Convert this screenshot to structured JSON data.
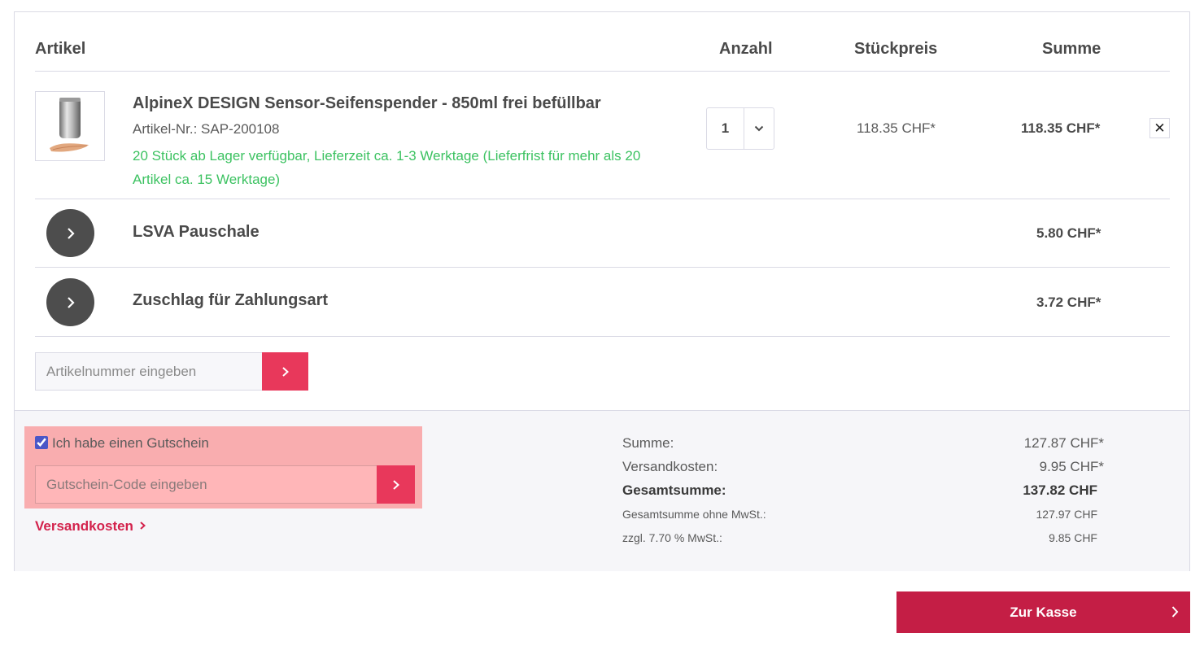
{
  "table_header": {
    "artikel": "Artikel",
    "anzahl": "Anzahl",
    "stueckpreis": "Stückpreis",
    "summe": "Summe"
  },
  "product": {
    "name": "AlpineX DESIGN Sensor-Seifenspender - 850ml frei befüllbar",
    "article_number": "Artikel-Nr.: SAP-200108",
    "availability": "20 Stück ab Lager verfügbar, Lieferzeit ca. 1-3 Werktage (Lieferfrist für mehr als 20 Artikel ca. 15 Werktage)",
    "quantity": "1",
    "unit_price": "118.35 CHF*",
    "total_price": "118.35 CHF*",
    "remove_label": "✕",
    "image_icon": "soap-dispenser-image"
  },
  "extra_rows": [
    {
      "title": "LSVA Pauschale",
      "price": "5.80 CHF*"
    },
    {
      "title": "Zuschlag für Zahlungsart",
      "price": "3.72 CHF*"
    }
  ],
  "article_input": {
    "placeholder": "Artikelnummer eingeben"
  },
  "voucher": {
    "checkbox_label": "Ich habe einen Gutschein",
    "checked": true,
    "placeholder": "Gutschein-Code eingeben"
  },
  "shipping_link": "Versandkosten",
  "summary": [
    {
      "label": "Summe:",
      "value": "127.87 CHF*"
    },
    {
      "label": "Versandkosten:",
      "value": "9.95 CHF*"
    },
    {
      "label": "Gesamtsumme:",
      "value": "137.82 CHF"
    },
    {
      "label": "Gesamtsumme ohne MwSt.:",
      "value": "127.97 CHF"
    },
    {
      "label": "zzgl. 7.70 % MwSt.:",
      "value": "9.85 CHF"
    }
  ],
  "checkout_label": "Zur Kasse",
  "colors": {
    "accent_red": "#e8385b",
    "checkout_red": "#c41e45",
    "link_red": "#d3224c",
    "available_green": "#3cc261",
    "voucher_highlight": "#f9adaf"
  }
}
